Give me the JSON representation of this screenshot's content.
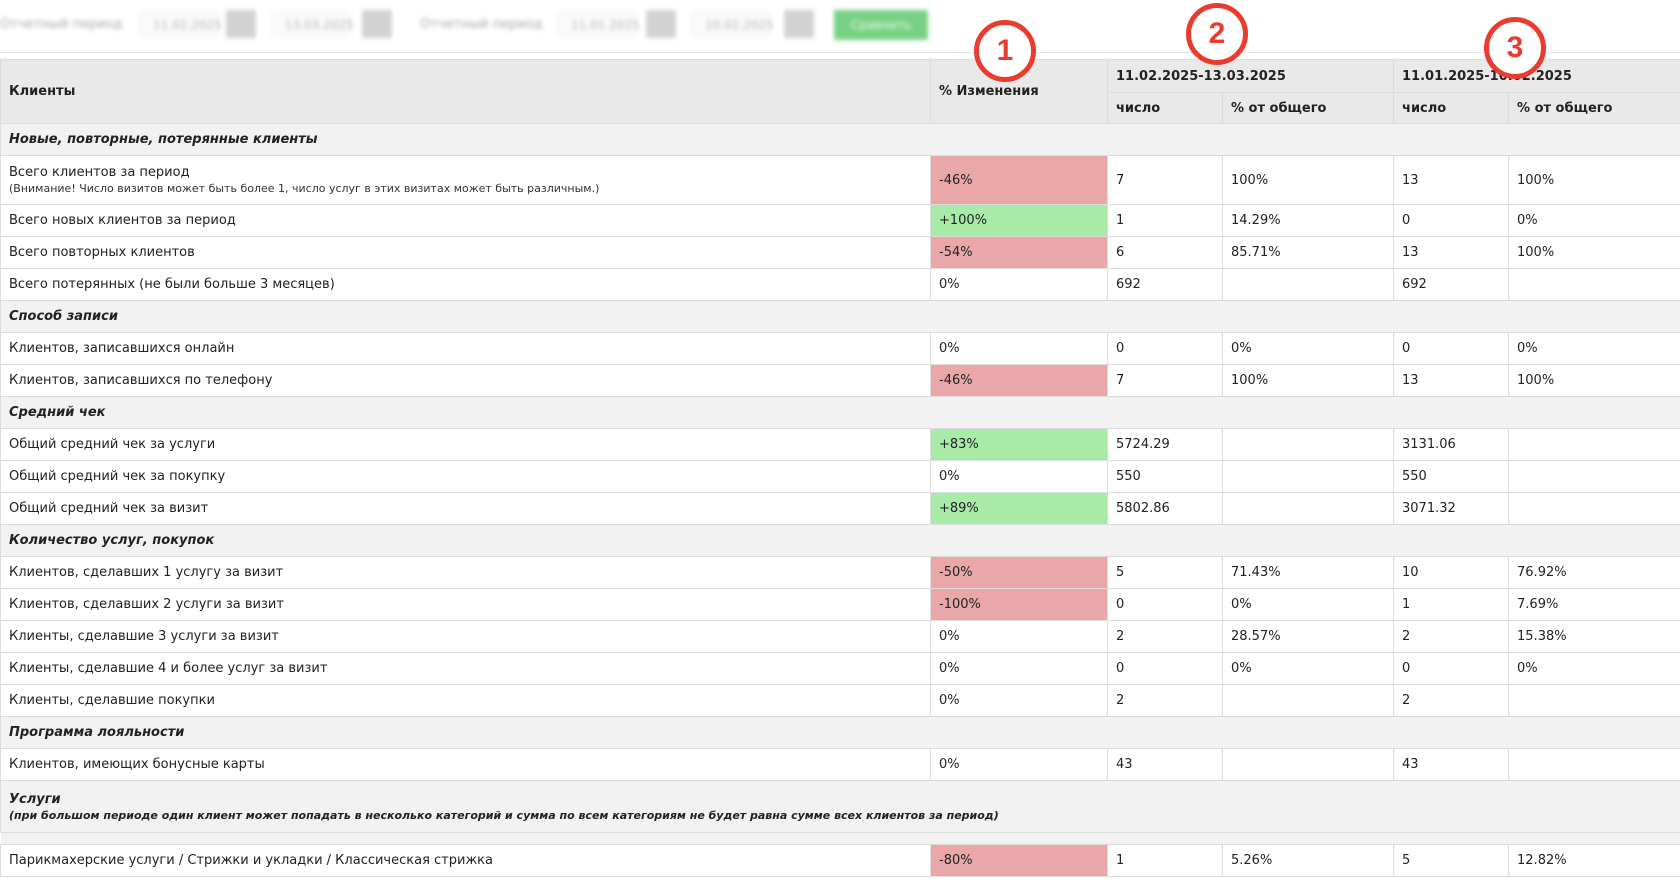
{
  "toolbar": {
    "period1_label": "Отчетный период",
    "period1_from": "11.02.2025",
    "period1_to": "13.03.2025",
    "period2_label": "Отчетный период",
    "period2_from": "11.01.2025",
    "period2_to": "10.02.2025",
    "submit_label": "Сравнить"
  },
  "markers": [
    "1",
    "2",
    "3"
  ],
  "header": {
    "clients": "Клиенты",
    "change": "% Изменения",
    "period1": "11.02.2025-13.03.2025",
    "period2": "11.01.2025-10.02.2025",
    "count": "число",
    "share": "% от общего"
  },
  "sections": {
    "s1": "Новые, повторные, потерянные клиенты",
    "s2": "Способ записи",
    "s3": "Средний чек",
    "s4": "Количество услуг, покупок",
    "s5": "Программа лояльности",
    "s6": "Услуги",
    "s6_note": "(при большом периоде один клиент может попадать в несколько категорий и сумма по всем категориям не будет равна сумме всех клиентов за период)"
  },
  "rows": {
    "r1": {
      "label": "Всего клиентов за период",
      "note": "(Внимание! Число визитов может быть более 1, число услуг в этих визитах может быть различным.)",
      "change": "-46%",
      "p1_count": "7",
      "p1_share": "100%",
      "p2_count": "13",
      "p2_share": "100%"
    },
    "r2": {
      "label": "Всего новых клиентов за период",
      "change": "+100%",
      "p1_count": "1",
      "p1_share": "14.29%",
      "p2_count": "0",
      "p2_share": "0%"
    },
    "r3": {
      "label": "Всего повторных клиентов",
      "change": "-54%",
      "p1_count": "6",
      "p1_share": "85.71%",
      "p2_count": "13",
      "p2_share": "100%"
    },
    "r4": {
      "label": "Всего потерянных (не были больше 3 месяцев)",
      "change": "0%",
      "p1_count": "692",
      "p1_share": "",
      "p2_count": "692",
      "p2_share": ""
    },
    "r5": {
      "label": "Клиентов, записавшихся онлайн",
      "change": "0%",
      "p1_count": "0",
      "p1_share": "0%",
      "p2_count": "0",
      "p2_share": "0%"
    },
    "r6": {
      "label": "Клиентов, записавшихся по телефону",
      "change": "-46%",
      "p1_count": "7",
      "p1_share": "100%",
      "p2_count": "13",
      "p2_share": "100%"
    },
    "r7": {
      "label": "Общий средний чек за услуги",
      "change": "+83%",
      "p1_count": "5724.29",
      "p1_share": "",
      "p2_count": "3131.06",
      "p2_share": ""
    },
    "r8": {
      "label": "Общий средний чек за покупку",
      "change": "0%",
      "p1_count": "550",
      "p1_share": "",
      "p2_count": "550",
      "p2_share": ""
    },
    "r9": {
      "label": "Общий средний чек за визит",
      "change": "+89%",
      "p1_count": "5802.86",
      "p1_share": "",
      "p2_count": "3071.32",
      "p2_share": ""
    },
    "r10": {
      "label": "Клиентов, сделавших 1 услугу за визит",
      "change": "-50%",
      "p1_count": "5",
      "p1_share": "71.43%",
      "p2_count": "10",
      "p2_share": "76.92%"
    },
    "r11": {
      "label": "Клиентов, сделавших 2 услуги за визит",
      "change": "-100%",
      "p1_count": "0",
      "p1_share": "0%",
      "p2_count": "1",
      "p2_share": "7.69%"
    },
    "r12": {
      "label": "Клиенты, сделавшие 3 услуги за визит",
      "change": "0%",
      "p1_count": "2",
      "p1_share": "28.57%",
      "p2_count": "2",
      "p2_share": "15.38%"
    },
    "r13": {
      "label": "Клиенты, сделавшие 4 и более услуг за визит",
      "change": "0%",
      "p1_count": "0",
      "p1_share": "0%",
      "p2_count": "0",
      "p2_share": "0%"
    },
    "r14": {
      "label": "Клиенты, сделавшие покупки",
      "change": "0%",
      "p1_count": "2",
      "p1_share": "",
      "p2_count": "2",
      "p2_share": ""
    },
    "r15": {
      "label": "Клиентов, имеющих бонусные карты",
      "change": "0%",
      "p1_count": "43",
      "p1_share": "",
      "p2_count": "43",
      "p2_share": ""
    },
    "r16": {
      "label": "Парикмахерские услуги / Стрижки и укладки / Классическая стрижка",
      "change": "-80%",
      "p1_count": "1",
      "p1_share": "5.26%",
      "p2_count": "5",
      "p2_share": "12.82%"
    }
  },
  "colors": {
    "negative": "#eaa7a8",
    "positive": "#a8eba8",
    "marker": "#ea3b2e",
    "button": "#4cc15b"
  }
}
